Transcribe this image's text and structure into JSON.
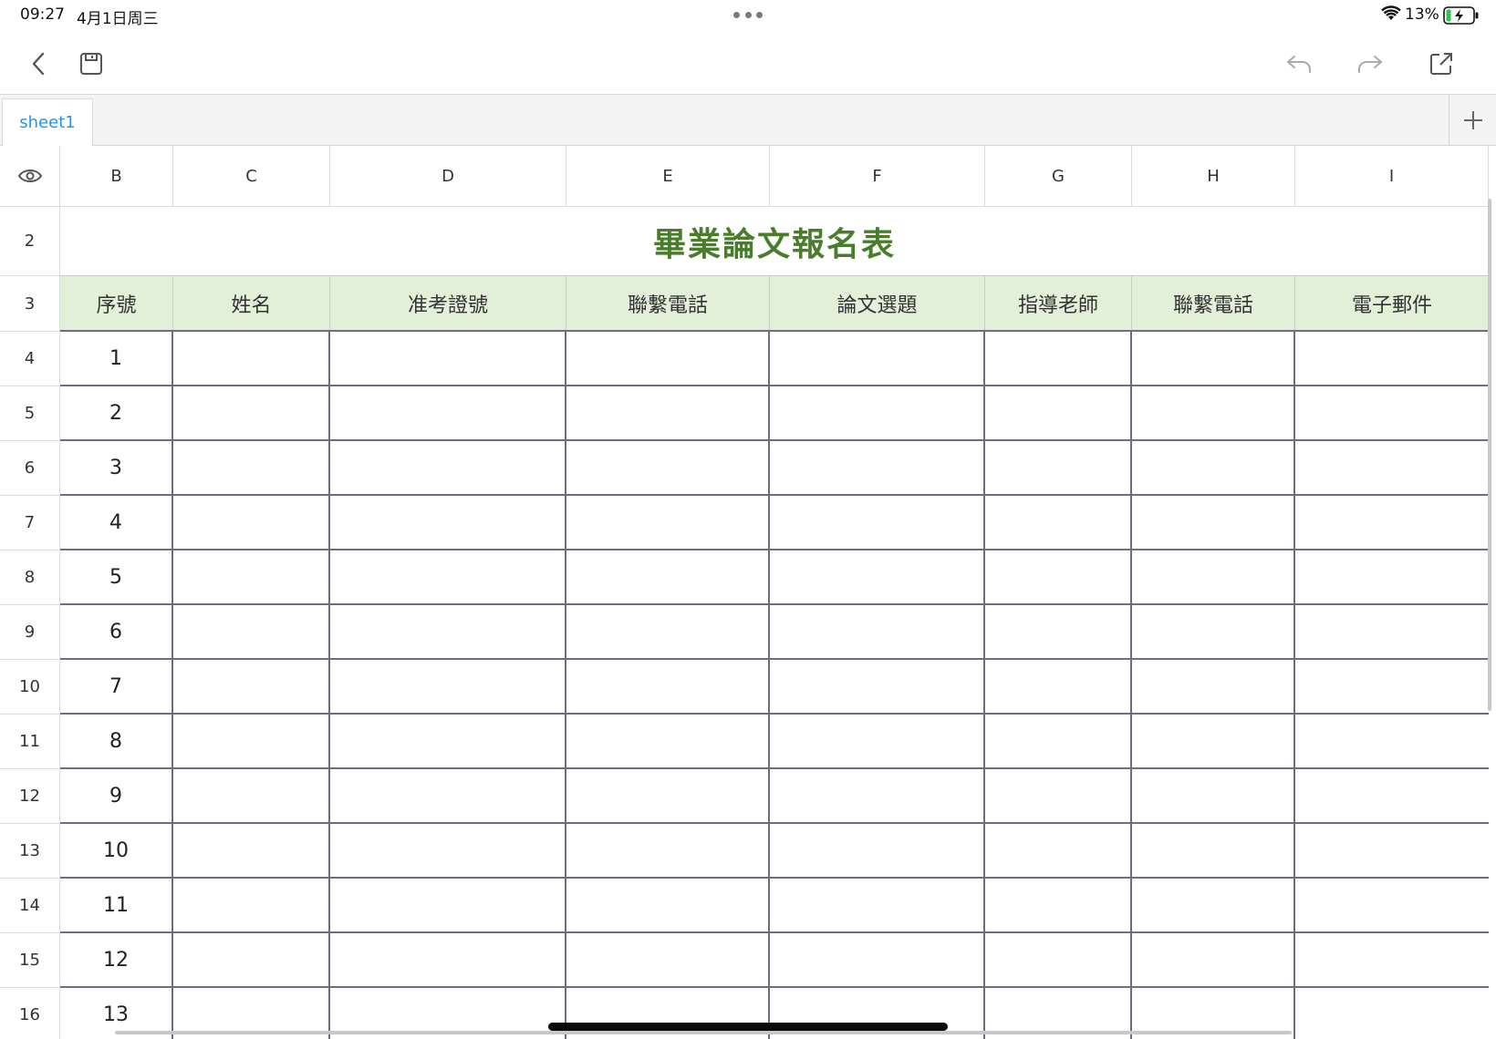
{
  "status_bar": {
    "time": "09:27",
    "date": "4月1日周三",
    "battery_percent": "13%",
    "battery_level": 0.13,
    "charging": true
  },
  "toolbar": {
    "back_icon": "chevron-left-icon",
    "save_icon": "save-icon",
    "undo_icon": "undo-icon",
    "redo_icon": "redo-icon",
    "share_icon": "share-icon"
  },
  "tabs": [
    {
      "label": "sheet1",
      "active": true
    }
  ],
  "add_tab_icon": "plus-icon",
  "columns": [
    "B",
    "C",
    "D",
    "E",
    "F",
    "G",
    "H",
    "I"
  ],
  "rows": [
    "2",
    "3",
    "4",
    "5",
    "6",
    "7",
    "8",
    "9",
    "10",
    "11",
    "12",
    "13",
    "14",
    "15",
    "16"
  ],
  "sheet": {
    "title": "畢業論文報名表",
    "headers": [
      "序號",
      "姓名",
      "准考證號",
      "聯繫電話",
      "論文選題",
      "指導老師",
      "聯繫電話",
      "電子郵件"
    ],
    "serials": [
      "1",
      "2",
      "3",
      "4",
      "5",
      "6",
      "7",
      "8",
      "9",
      "10",
      "11",
      "12",
      "13"
    ]
  },
  "colors": {
    "title": "#4a7d2b",
    "header_fill": "#e2efd9",
    "grid_line": "#6b6e80",
    "tab_active": "#2196f3"
  }
}
